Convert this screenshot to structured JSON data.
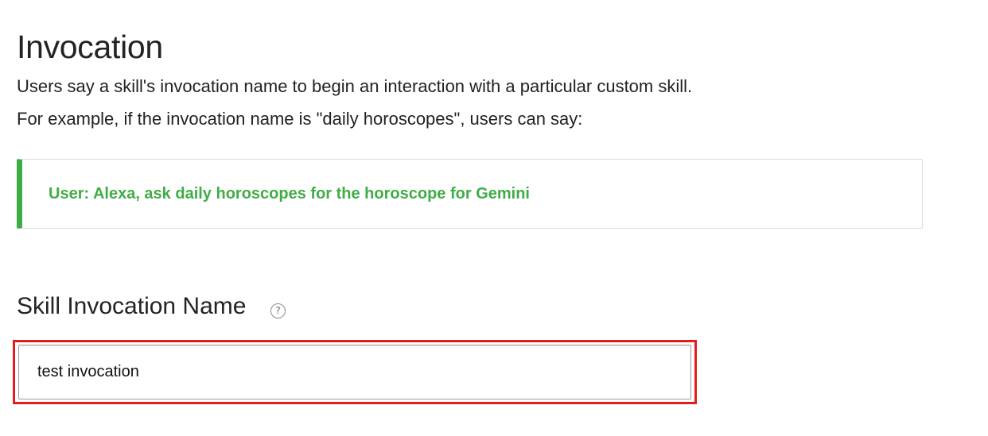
{
  "section": {
    "title": "Invocation",
    "description_line1": "Users say a skill's invocation name to begin an interaction with a particular custom skill.",
    "description_line2": "For example, if the invocation name is \"daily horoscopes\", users can say:"
  },
  "example": {
    "text": "User: Alexa, ask daily horoscopes for the horoscope for Gemini",
    "accent_color": "#3fad46"
  },
  "invocation_field": {
    "label": "Skill Invocation Name",
    "help_icon": "question-circle-icon",
    "help_glyph": "?",
    "value": "test invocation",
    "highlight_color": "#e51c1c"
  }
}
